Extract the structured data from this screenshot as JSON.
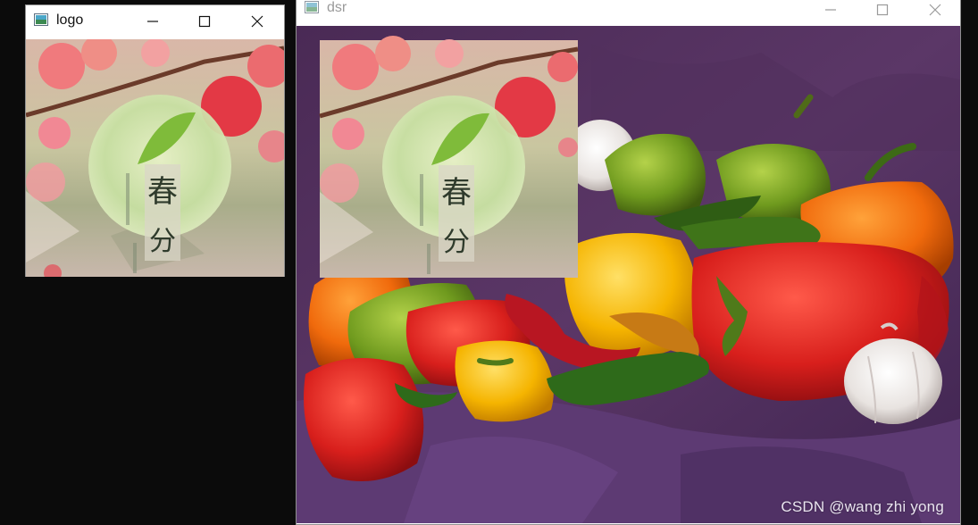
{
  "windows": {
    "logo": {
      "title": "logo"
    },
    "dsr": {
      "title": "dsr"
    }
  },
  "logo_image": {
    "char_top": "春",
    "char_bottom": "分"
  },
  "overlay": {
    "char_top": "春",
    "char_bottom": "分"
  },
  "watermark": "CSDN @wang zhi yong",
  "icons": [
    "app-icon",
    "minimize-icon",
    "maximize-icon",
    "close-icon"
  ]
}
